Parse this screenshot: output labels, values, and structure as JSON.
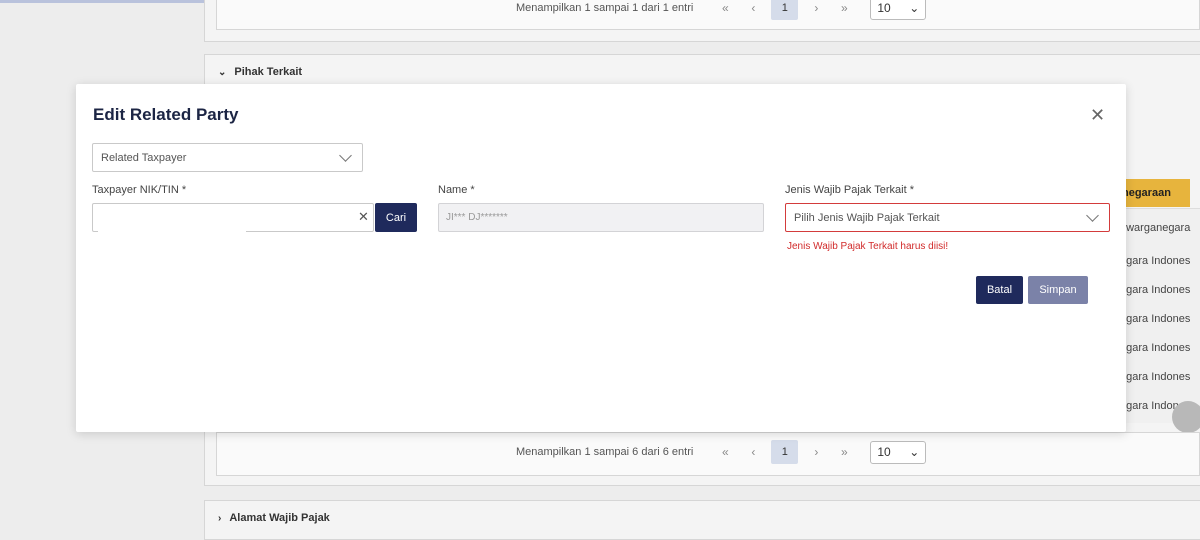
{
  "background": {
    "top_pager": {
      "text": "Menampilkan 1 sampai 1 dari 1 entri",
      "first": "«",
      "prev": "‹",
      "current": "1",
      "next": "›",
      "last": "»",
      "per_page": "10"
    },
    "section_related": {
      "title": "Pihak Terkait"
    },
    "bottom_pager": {
      "text": "Menampilkan 1 sampai 6 dari 6 entri",
      "first": "«",
      "prev": "‹",
      "current": "1",
      "next": "›",
      "last": "»",
      "per_page": "10"
    },
    "section_address": {
      "title": "Alamat Wajib Pajak"
    },
    "column_header": "negaraan",
    "rows": [
      "ewarganegara",
      "egara Indones",
      "egara Indones",
      "egara Indones",
      "egara Indones",
      "egara Indones",
      "egara Indones"
    ]
  },
  "modal": {
    "title": "Edit Related Party",
    "type_select": {
      "value": "Related Taxpayer"
    },
    "nik": {
      "label": "Taxpayer NIK/TIN *",
      "value": "",
      "search_label": "Cari"
    },
    "name": {
      "label": "Name *",
      "value": "JI*** DJ*******"
    },
    "jenis": {
      "label": "Jenis Wajib Pajak Terkait *",
      "placeholder": "Pilih Jenis Wajib Pajak Terkait",
      "error": "Jenis Wajib Pajak Terkait harus diisi!"
    },
    "cancel_label": "Batal",
    "save_label": "Simpan"
  },
  "colors": {
    "primary": "#1f2a5c",
    "error": "#d12b2b",
    "accent_gold": "#e7b43d"
  }
}
